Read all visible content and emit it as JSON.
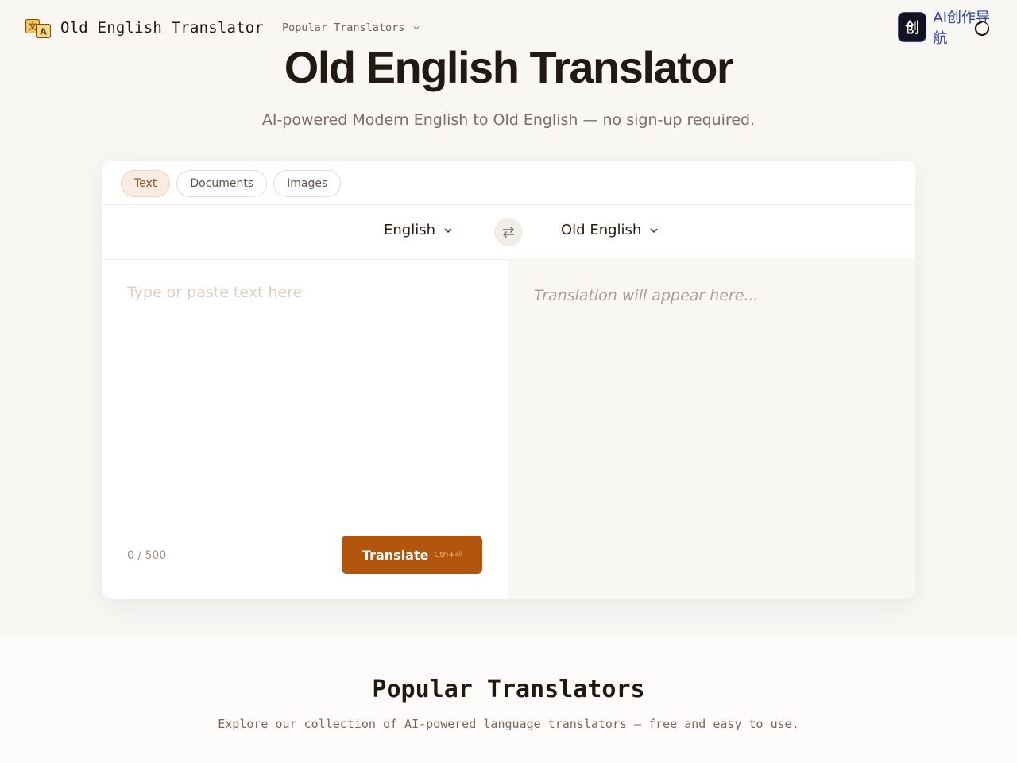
{
  "header": {
    "logo_text": "Old English Translator",
    "nav_popular": "Popular Translators",
    "badge_glyph": "创",
    "badge_text": "AI创作导航"
  },
  "hero": {
    "title": "Old English Translator",
    "subtitle": "AI-powered Modern English to Old English — no sign-up required."
  },
  "tabs": [
    {
      "label": "Text",
      "active": true
    },
    {
      "label": "Documents",
      "active": false
    },
    {
      "label": "Images",
      "active": false
    }
  ],
  "languages": {
    "source": "English",
    "target": "Old English"
  },
  "input": {
    "placeholder": "Type or paste text here",
    "value": "",
    "counter": "0 / 500"
  },
  "translate": {
    "label": "Translate",
    "shortcut": "Ctrl+⏎"
  },
  "output": {
    "placeholder": "Translation will appear here..."
  },
  "section": {
    "title": "Popular Translators",
    "subtitle": "Explore our collection of AI-powered language translators — free and easy to use."
  },
  "colors": {
    "accent": "#b1560c",
    "background": "#f8f7f4",
    "active_tab_bg": "#f9ece0"
  },
  "icons": {
    "logo": "translate-icon",
    "swap": "swap-arrows-icon",
    "theme": "theme-toggle-icon",
    "dropdown": "chevron-down-icon"
  }
}
